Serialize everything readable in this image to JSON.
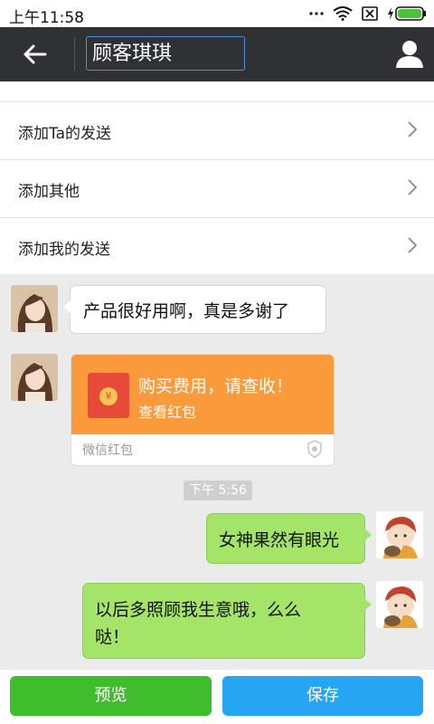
{
  "status_bar": {
    "time": "上午11:58"
  },
  "header": {
    "title_value": "顾客琪琪"
  },
  "menu": {
    "items": [
      {
        "label": "添加Ta的发送"
      },
      {
        "label": "添加其他"
      },
      {
        "label": "添加我的发送"
      }
    ]
  },
  "chat": {
    "messages": [
      {
        "text": "产品很好用啊，真是多谢了"
      },
      {
        "text": "女神果然有眼光"
      },
      {
        "text_line1": "以后多照顾我生意哦，么么",
        "text_line2": "哒！"
      }
    ],
    "red_packet": {
      "title": "购买费用，请查收！",
      "subtitle": "查看红包",
      "footer": "微信红包",
      "seal_symbol": "¥"
    },
    "timestamp": "下午 5:56"
  },
  "actions": {
    "preview_label": "预览",
    "save_label": "保存"
  },
  "colors": {
    "accent_green": "#3fbd2c",
    "accent_blue": "#26a5f3",
    "bubble_green": "#a4e468",
    "red_packet_orange": "#fa9a3b"
  }
}
